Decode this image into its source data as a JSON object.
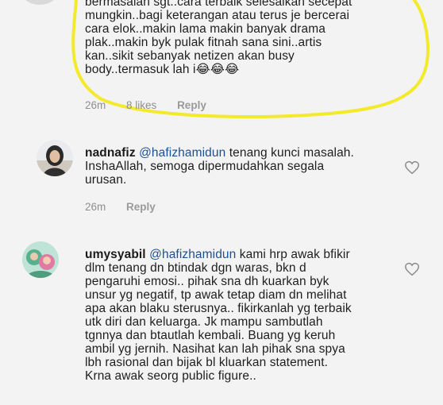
{
  "comments": [
    {
      "username": "",
      "mention": "",
      "text_lines": [
        "bermasalah sgt..cara terbaik selesaikan secepat",
        "mungkin..bagi keterangan atau terus je bercerai",
        "cara elok..makin lama makin banyak drama",
        "plak..makin byk pulak fitnah sana sini..artis",
        "kan..sikit sebanyak netizen akan busy",
        "body..termasuk lah i😂😂😂"
      ],
      "time": "26m",
      "likes": "8 likes",
      "reply": "Reply"
    },
    {
      "username": "nadnafiz",
      "mention": "@hafizhamidun",
      "first_line_rest": " tenang kunci masalah.",
      "text_lines": [
        "InshaAllah, semoga dipermudahkan segala",
        "urusan."
      ],
      "time": "26m",
      "reply": "Reply"
    },
    {
      "username": "umysyabil",
      "mention": "@hafizhamidun",
      "first_line_rest": " kami hrp awak bfikir",
      "text_lines": [
        "dlm tenang dn btindak dgn waras, bkn d",
        "pengaruhi emosi.. pihak sna dh kuarkan byk",
        "unsur yg negatif, tp awak tetap diam dn melihat",
        "apa akan blaku sterusnya.. fikirkanlah yg terbaik",
        "utk diri dan keluarga. Jk mampu sambutlah",
        "tgnnya dan btautlah kembali. Buang yg keruh",
        "ambil yg jernih. Nasihat kan lah pihak sna spya",
        "lbh rasional dan bijak bl kluarkan statement.",
        "Krna awak seorg public figure.."
      ]
    }
  ],
  "colors": {
    "highlight": "#f2ea2b",
    "mention": "#1e4f8f",
    "meta": "#8f8f8f",
    "background": "#f3f3f3"
  },
  "icons": {
    "like": "heart-outline-icon"
  }
}
